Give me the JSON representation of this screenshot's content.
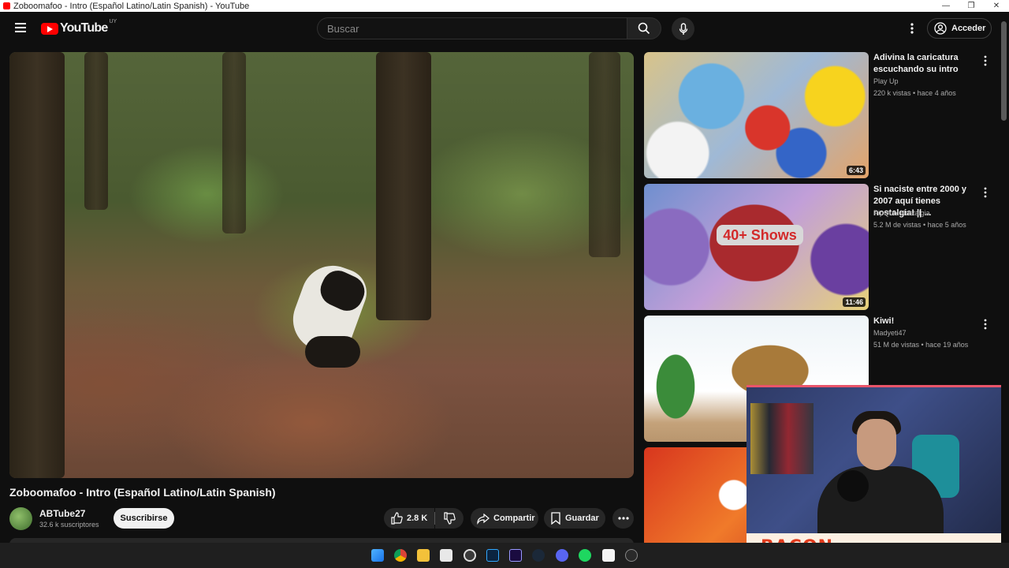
{
  "window": {
    "title": "Zoboomafoo - Intro (Español Latino/Latin Spanish) - YouTube",
    "minimize": "—",
    "maximize": "❐",
    "close": "✕"
  },
  "header": {
    "logo_text": "YouTube",
    "country_code": "UY",
    "search_placeholder": "Buscar",
    "signin_label": "Acceder"
  },
  "video": {
    "title": "Zoboomafoo - Intro (Español Latino/Latin Spanish)",
    "channel": "ABTube27",
    "subscribers": "32.6 k suscriptores",
    "subscribe_label": "Suscribirse",
    "likes": "2.8 K",
    "share_label": "Compartir",
    "save_label": "Guardar"
  },
  "recommendations": [
    {
      "title": "Adivina la caricatura escuchando su intro",
      "channel": "Play Up",
      "meta": "220 k vistas • hace 4 años",
      "duration": "6:43"
    },
    {
      "title": "Si naciste entre 2000 y 2007 aquí tienes nostalgia! || ...",
      "channel": "PipQuix Nostalgia",
      "meta": "5.2 M de vistas • hace 5 años",
      "duration": "11:46",
      "thumb_text": "40+ Shows"
    },
    {
      "title": "Kiwi!",
      "channel": "Madyeti47",
      "meta": "51 M de vistas • hace 19 años",
      "duration": ""
    }
  ],
  "overlay": {
    "webcam_banner": "BACON"
  },
  "colors": {
    "background": "#0f0f0f",
    "brand_red": "#ff0000",
    "banner_text": "#e03a1c"
  }
}
